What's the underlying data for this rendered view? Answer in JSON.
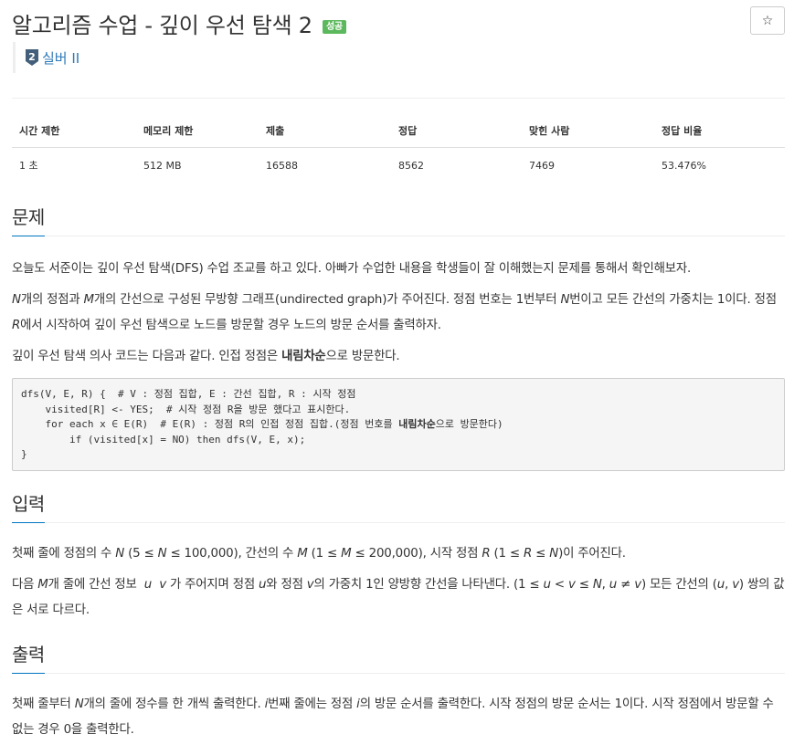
{
  "header": {
    "title": "알고리즘 수업 - 깊이 우선 탐색 2",
    "result_badge": "성공",
    "star_icon": "☆",
    "tier_number": "2",
    "tier_label": "실버 II",
    "tier_color": "#435f7a",
    "badge_color": "#5cb85c",
    "link_color": "#2e7ab8"
  },
  "info_table": {
    "headers": [
      "시간 제한",
      "메모리 제한",
      "제출",
      "정답",
      "맞힌 사람",
      "정답 비율"
    ],
    "values": [
      "1 초",
      "512 MB",
      "16588",
      "8562",
      "7469",
      "53.476%"
    ]
  },
  "problem": {
    "heading": "문제",
    "p1": "오늘도 서준이는 깊이 우선 탐색(DFS) 수업 조교를 하고 있다. 아빠가 수업한 내용을 학생들이 잘 이해했는지 문제를 통해서 확인해보자.",
    "p2_a": "N",
    "p2_b": "개의 정점과 ",
    "p2_c": "M",
    "p2_d": "개의 간선으로 구성된 무방향 그래프(undirected graph)가 주어진다. 정점 번호는 1번부터 ",
    "p2_e": "N",
    "p2_f": "번이고 모든 간선의 가중치는 1이다. 정점 ",
    "p2_g": "R",
    "p2_h": "에서 시작하여 깊이 우선 탐색으로 노드를 방문할 경우 노드의 방문 순서를 출력하자.",
    "p3_a": "깊이 우선 탐색 의사 코드는 다음과 같다. 인접 정점은 ",
    "p3_b": "내림차순",
    "p3_c": "으로 방문한다.",
    "code_l1": "dfs(V, E, R) {  # V : 정점 집합, E : 간선 집합, R : 시작 정점",
    "code_l2": "    visited[R] <- YES;  # 시작 정점 R을 방문 했다고 표시한다.",
    "code_l3a": "    for each x ∈ E(R)  # E(R) : 정점 R의 인접 정점 집합.(정점 번호를 ",
    "code_l3b": "내림차순",
    "code_l3c": "으로 방문한다)",
    "code_l4": "        if (visited[x] = NO) then dfs(V, E, x);",
    "code_l5": "}"
  },
  "input": {
    "heading": "입력",
    "p1_a": "첫째 줄에 정점의 수 ",
    "p1_b": "N",
    "p1_c": " (5 ≤ ",
    "p1_d": "N",
    "p1_e": " ≤ 100,000), 간선의 수 ",
    "p1_f": "M",
    "p1_g": " (1 ≤ ",
    "p1_h": "M",
    "p1_i": " ≤ 200,000), 시작 정점 ",
    "p1_j": "R",
    "p1_k": " (1 ≤ ",
    "p1_l": "R",
    "p1_m": " ≤ ",
    "p1_n": "N",
    "p1_o": ")이 주어진다.",
    "p2_a": "다음 ",
    "p2_b": "M",
    "p2_c": "개 줄에 간선 정보  ",
    "p2_d": "u",
    "p2_e": "  ",
    "p2_f": "v",
    "p2_g": " 가 주어지며 정점 ",
    "p2_h": "u",
    "p2_i": "와 정점 ",
    "p2_j": "v",
    "p2_k": "의 가중치 1인 양방향 간선을 나타낸다. (1 ≤ ",
    "p2_l": "u",
    "p2_m": " < ",
    "p2_n": "v",
    "p2_o": " ≤ ",
    "p2_p": "N",
    "p2_q": ", ",
    "p2_r": "u",
    "p2_s": " ≠ ",
    "p2_t": "v",
    "p2_u": ") 모든 간선의 (",
    "p2_v": "u",
    "p2_w": ", ",
    "p2_x": "v",
    "p2_y": ") 쌍의 값은 서로 다르다."
  },
  "output": {
    "heading": "출력",
    "p1_a": "첫째 줄부터 ",
    "p1_b": "N",
    "p1_c": "개의 줄에 정수를 한 개씩 출력한다. ",
    "p1_d": "i",
    "p1_e": "번째 줄에는 정점 ",
    "p1_f": "i",
    "p1_g": "의 방문 순서를 출력한다. 시작 정점의 방문 순서는 1이다. 시작 정점에서 방문할 수 없는 경우 0을 출력한다."
  }
}
